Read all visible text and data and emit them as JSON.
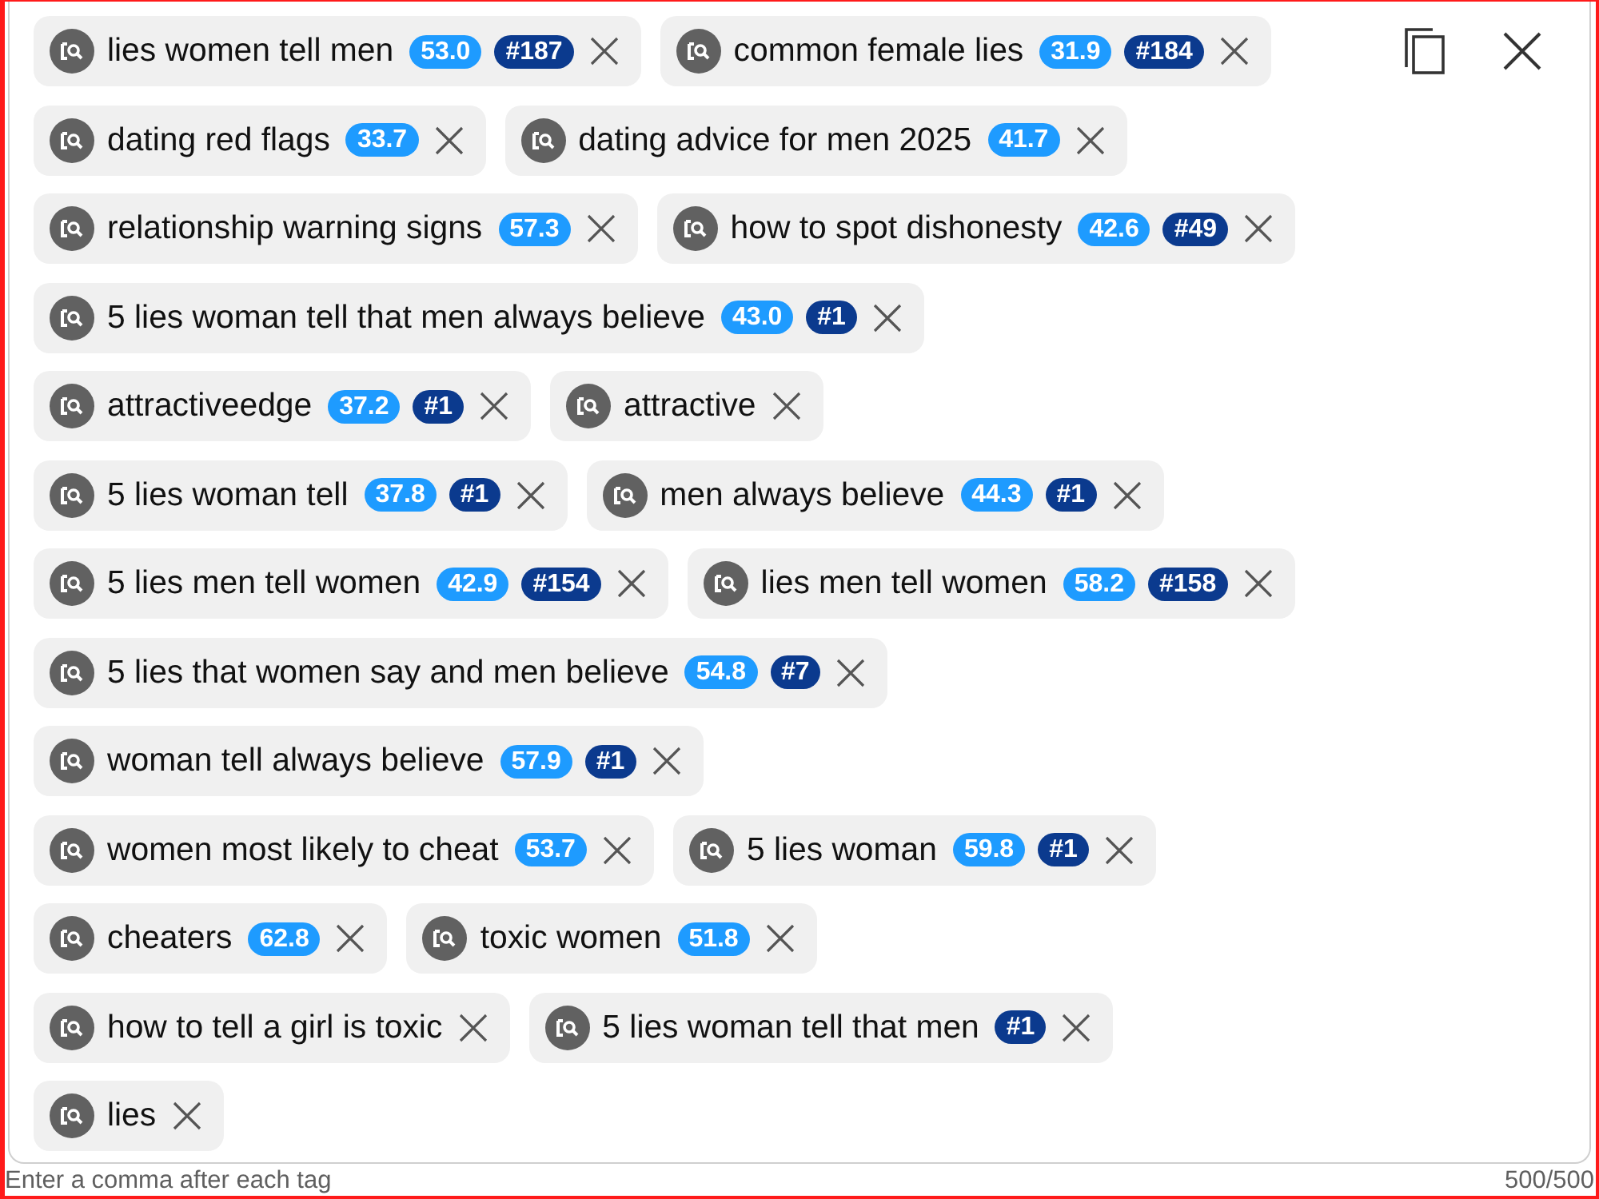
{
  "tags_field": {
    "tags": [
      {
        "text": "lies women tell men",
        "score": "53.0",
        "rank": "#187"
      },
      {
        "text": "common female lies",
        "score": "31.9",
        "rank": "#184"
      },
      {
        "text": "dating red flags",
        "score": "33.7"
      },
      {
        "text": "dating advice for men 2025",
        "score": "41.7"
      },
      {
        "text": "relationship warning signs",
        "score": "57.3"
      },
      {
        "text": "how to spot dishonesty",
        "score": "42.6",
        "rank": "#49"
      },
      {
        "text": "5 lies woman tell that men always believe",
        "score": "43.0",
        "rank": "#1"
      },
      {
        "text": "attractiveedge",
        "score": "37.2",
        "rank": "#1"
      },
      {
        "text": "attractive"
      },
      {
        "text": "5 lies woman tell",
        "score": "37.8",
        "rank": "#1"
      },
      {
        "text": "men always believe",
        "score": "44.3",
        "rank": "#1"
      },
      {
        "text": "5 lies men tell women",
        "score": "42.9",
        "rank": "#154"
      },
      {
        "text": "lies men tell women",
        "score": "58.2",
        "rank": "#158"
      },
      {
        "text": "5 lies that women say and men believe",
        "score": "54.8",
        "rank": "#7"
      },
      {
        "text": "woman tell always believe",
        "score": "57.9",
        "rank": "#1"
      },
      {
        "text": "women most likely to cheat",
        "score": "53.7"
      },
      {
        "text": "5 lies woman",
        "score": "59.8",
        "rank": "#1"
      },
      {
        "text": "cheaters",
        "score": "62.8"
      },
      {
        "text": "toxic women",
        "score": "51.8"
      },
      {
        "text": "how to tell a girl is toxic"
      },
      {
        "text": "5 lies woman tell that men",
        "rank": "#1"
      },
      {
        "text": "lies"
      }
    ]
  },
  "helper_text": "Enter a comma after each tag",
  "counter": "500/500"
}
